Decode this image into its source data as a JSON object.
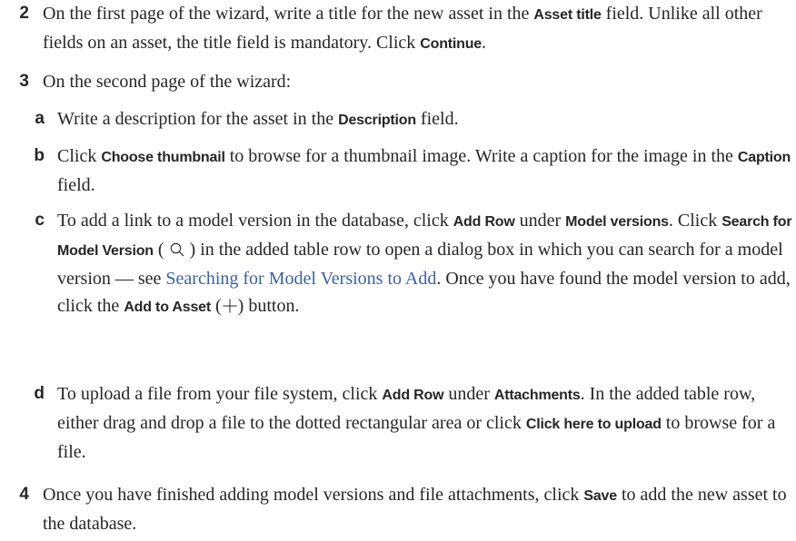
{
  "steps": {
    "s2": {
      "number": "2",
      "t1": "On the first page of the wizard, write a title for the new asset in the ",
      "b1": "Asset title",
      "t2": " field. Unlike all other fields on an asset, the title field is mandatory. Click ",
      "b2": "Continue",
      "t3": "."
    },
    "s3": {
      "number": "3",
      "text": "On the second page of the wizard:",
      "a": {
        "letter": "a",
        "t1": "Write a description for the asset in the ",
        "b1": "Description",
        "t2": " field."
      },
      "b": {
        "letter": "b",
        "t1": "Click ",
        "b1": "Choose thumbnail",
        "t2": " to browse for a thumbnail image. Write a caption for the image in the ",
        "b2": "Caption",
        "t3": " field."
      },
      "c": {
        "letter": "c",
        "t1": "To add a link to a model version in the database, click ",
        "b1": "Add Row",
        "t2": " under ",
        "b2": "Model versions",
        "t3": ". Click ",
        "b3": "Search for Model Version",
        "t4": " ( ",
        "t5": " ) in the added table row to open a dialog box in which you can search for a model version — see ",
        "link": "Searching for Model Versions to Add",
        "t6": ". Once you have found the model version to add, click the ",
        "b4": "Add to Asset",
        "t7": " (",
        "t8": ") button.",
        "search_icon": "magnifier-icon",
        "add_icon": "plus-icon"
      },
      "d": {
        "letter": "d",
        "t1": "To upload a file from your file system, click ",
        "b1": "Add Row",
        "t2": " under ",
        "b2": "Attachments",
        "t3": ". In the added table row, either drag and drop a file to the dotted rectangular area or click ",
        "b3": "Click here to upload",
        "t4": " to browse for a file."
      }
    },
    "s4": {
      "number": "4",
      "t1": "Once you have finished adding model versions and file attachments, click ",
      "b1": "Save",
      "t2": " to add the new asset to the database."
    }
  },
  "colors": {
    "text": "#262626",
    "link": "#3b5fa8"
  }
}
